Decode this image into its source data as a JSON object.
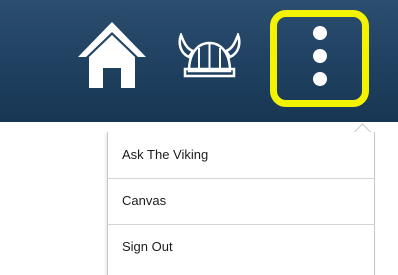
{
  "header": {
    "background_color": "#1f4060",
    "home_icon": "home-icon",
    "helmet_icon": "viking-helmet-icon",
    "menu_icon": "more-vertical-icon",
    "highlight_color": "#f3f300"
  },
  "dropdown": {
    "items": [
      {
        "label": "Ask The Viking"
      },
      {
        "label": "Canvas"
      },
      {
        "label": "Sign Out"
      }
    ]
  }
}
